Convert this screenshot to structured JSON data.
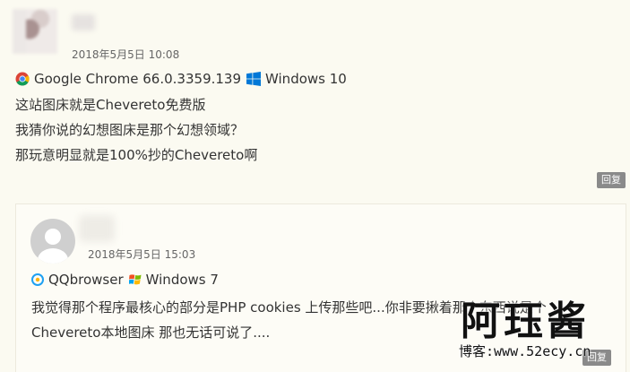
{
  "comment": {
    "date": "2018年5月5日 10:08",
    "browser": "Google Chrome 66.0.3359.139",
    "os": "Windows 10",
    "lines": [
      "这站图床就是Chevereto免费版",
      "我猜你说的幻想图床是那个幻想领域？",
      "那玩意明显就是100%抄的Chevereto啊"
    ],
    "reply_label": "回复"
  },
  "reply": {
    "date": "2018年5月5日 15:03",
    "browser": "QQbrowser",
    "os": "Windows 7",
    "lines": [
      "我觉得那个程序最核心的部分是PHP cookies 上传那些吧...你非要揪着那个东西说是个",
      "Chevereto本地图床 那也无话可说了...."
    ],
    "reply_label": "回复"
  },
  "watermark": {
    "title": "阿珏酱",
    "url": "博客:www.52ecy.cn"
  },
  "icons": {
    "chrome": "chrome-icon",
    "windows10": "windows10-icon",
    "qqbrowser": "qqbrowser-icon",
    "windows7": "windows7-icon"
  },
  "colors": {
    "background": "#fbfaf1",
    "text": "#333333",
    "date": "#666666",
    "reply_button": "#8a8a8a"
  }
}
